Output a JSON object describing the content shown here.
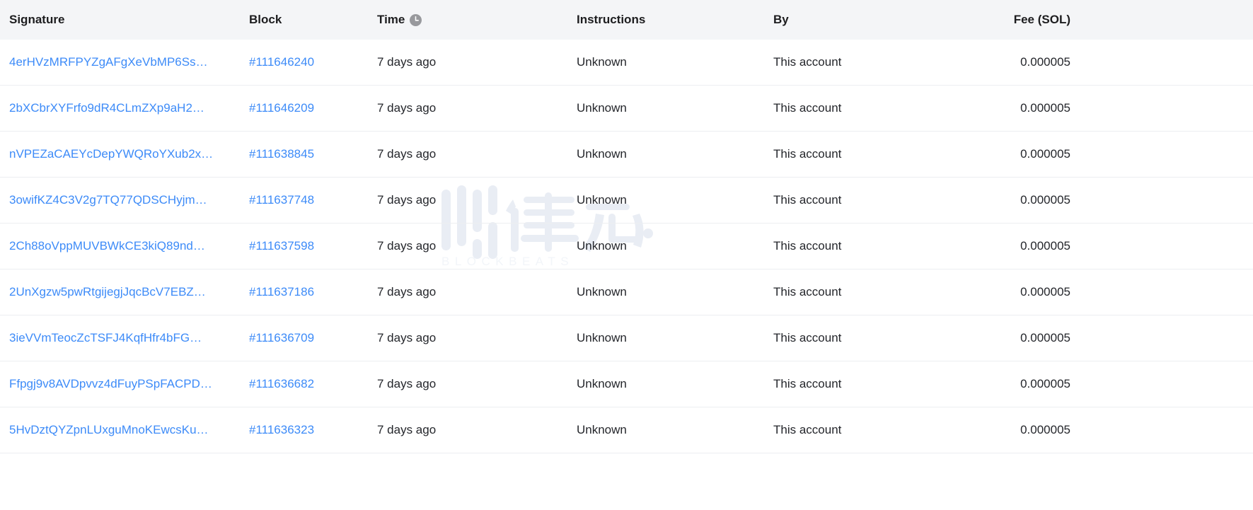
{
  "table": {
    "columns": [
      {
        "key": "signature",
        "label": "Signature",
        "align": "left",
        "icon": null
      },
      {
        "key": "block",
        "label": "Block",
        "align": "left",
        "icon": null
      },
      {
        "key": "time",
        "label": "Time",
        "align": "left",
        "icon": "clock-icon"
      },
      {
        "key": "instructions",
        "label": "Instructions",
        "align": "left",
        "icon": null
      },
      {
        "key": "by",
        "label": "By",
        "align": "left",
        "icon": null
      },
      {
        "key": "fee",
        "label": "Fee (SOL)",
        "align": "right",
        "icon": null
      }
    ],
    "rows": [
      {
        "signature": "4erHVzMRFPYZgAFgXeVbMP6Ss…",
        "block": "#111646240",
        "time": "7 days ago",
        "instructions": "Unknown",
        "by": "This account",
        "fee": "0.000005"
      },
      {
        "signature": "2bXCbrXYFrfo9dR4CLmZXp9aH2…",
        "block": "#111646209",
        "time": "7 days ago",
        "instructions": "Unknown",
        "by": "This account",
        "fee": "0.000005"
      },
      {
        "signature": "nVPEZaCAEYcDepYWQRoYXub2x…",
        "block": "#111638845",
        "time": "7 days ago",
        "instructions": "Unknown",
        "by": "This account",
        "fee": "0.000005"
      },
      {
        "signature": "3owifKZ4C3V2g7TQ77QDSCHyjm…",
        "block": "#111637748",
        "time": "7 days ago",
        "instructions": "Unknown",
        "by": "This account",
        "fee": "0.000005"
      },
      {
        "signature": "2Ch88oVppMUVBWkCE3kiQ89nd…",
        "block": "#111637598",
        "time": "7 days ago",
        "instructions": "Unknown",
        "by": "This account",
        "fee": "0.000005"
      },
      {
        "signature": "2UnXgzw5pwRtgijegjJqcBcV7EBZ…",
        "block": "#111637186",
        "time": "7 days ago",
        "instructions": "Unknown",
        "by": "This account",
        "fee": "0.000005"
      },
      {
        "signature": "3ieVVmTeocZcTSFJ4KqfHfr4bFG…",
        "block": "#111636709",
        "time": "7 days ago",
        "instructions": "Unknown",
        "by": "This account",
        "fee": "0.000005"
      },
      {
        "signature": "Ffpgj9v8AVDpvvz4dFuyPSpFACPD…",
        "block": "#111636682",
        "time": "7 days ago",
        "instructions": "Unknown",
        "by": "This account",
        "fee": "0.000005"
      },
      {
        "signature": "5HvDztQYZpnLUxguMnoKEwcsKu…",
        "block": "#111636323",
        "time": "7 days ago",
        "instructions": "Unknown",
        "by": "This account",
        "fee": "0.000005"
      }
    ]
  },
  "watermark": {
    "mark": "律动",
    "wordmark": "BLOCKBEATS"
  },
  "colors": {
    "link": "#3d8bf8",
    "header_bg": "#f4f5f7",
    "text": "#24262b",
    "row_border": "#eceef1",
    "watermark": "#e9edf4"
  }
}
